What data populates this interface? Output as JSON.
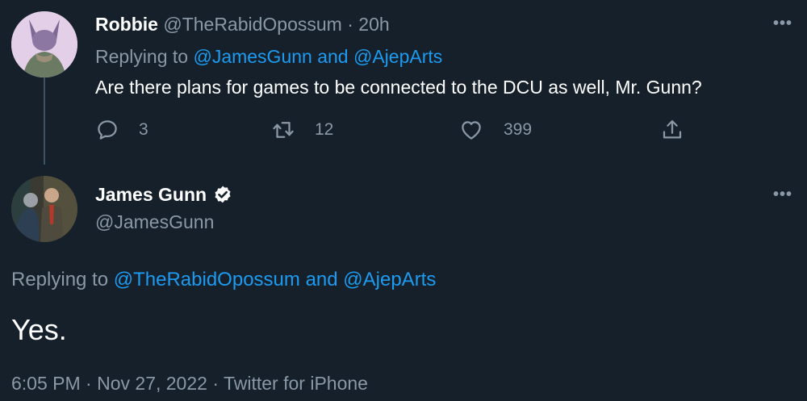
{
  "reply_tweet": {
    "author_name": "Robbie",
    "author_handle": "@TheRabidOpossum",
    "separator": "·",
    "time_ago": "20h",
    "replying_label": "Replying to",
    "replying_mention_1": "@JamesGunn",
    "replying_and": "and",
    "replying_mention_2": "@AjepArts",
    "text": "Are there plans for games to be connected to the DCU as well, Mr. Gunn?",
    "more_icon": "more-icon",
    "actions": {
      "reply_count": "3",
      "retweet_count": "12",
      "like_count": "399"
    }
  },
  "main_tweet": {
    "author_name": "James Gunn",
    "author_handle": "@JamesGunn",
    "verified_icon": "verified-badge-icon",
    "replying_label": "Replying to",
    "replying_mention_1": "@TheRabidOpossum",
    "replying_and": "and",
    "replying_mention_2": "@AjepArts",
    "text": "Yes.",
    "time": "6:05 PM",
    "separator": "·",
    "date": "Nov 27, 2022",
    "source": "Twitter for iPhone"
  },
  "colors": {
    "background": "#15202b",
    "text": "#ffffff",
    "secondary": "#8b98a5",
    "link": "#1d9bf0"
  }
}
